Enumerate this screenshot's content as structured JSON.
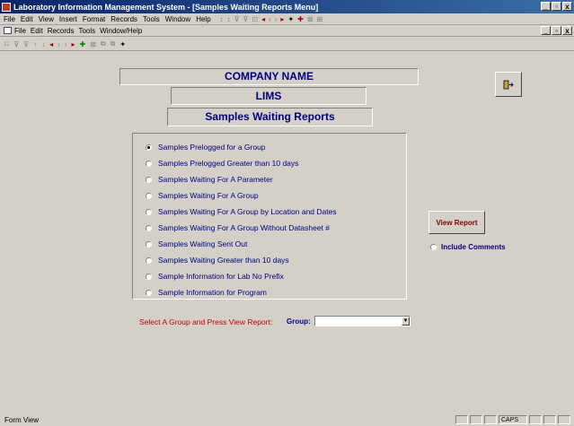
{
  "window": {
    "title": "Laboratory Information Management System - [Samples Waiting Reports Menu]",
    "controls": [
      "_",
      "▫",
      "x"
    ]
  },
  "menu1": {
    "items": [
      "File",
      "Edit",
      "View",
      "Insert",
      "Format",
      "Records",
      "Tools",
      "Window",
      "Help"
    ]
  },
  "menu2": {
    "items": [
      "File",
      "Edit",
      "Records",
      "Tools",
      "Window/Help"
    ],
    "controls": [
      "_",
      "▫",
      "x"
    ]
  },
  "form": {
    "company": "COMPANY NAME",
    "app": "LIMS",
    "heading": "Samples Waiting Reports",
    "options": [
      {
        "label": "Samples Prelogged for a Group",
        "selected": true
      },
      {
        "label": "Samples Prelogged Greater than 10 days",
        "selected": false
      },
      {
        "label": "Samples Waiting For A Parameter",
        "selected": false
      },
      {
        "label": "Samples Waiting For A Group",
        "selected": false
      },
      {
        "label": "Samples Waiting For A Group by Location and Dates",
        "selected": false
      },
      {
        "label": "Samples Waiting For A Group Without Datasheet #",
        "selected": false
      },
      {
        "label": "Samples Waiting Sent Out",
        "selected": false
      },
      {
        "label": "Samples Waiting Greater than 10 days",
        "selected": false
      },
      {
        "label": "Sample Information for Lab No Prefix",
        "selected": false
      },
      {
        "label": "Sample Information for Program",
        "selected": false
      }
    ],
    "view_report": "View Report",
    "include_comments": "Include Comments",
    "prompt": "Select A Group and Press View Report:",
    "group_label": "Group:",
    "group_value": ""
  },
  "status": {
    "left": "Form View",
    "caps": "CAPS"
  }
}
